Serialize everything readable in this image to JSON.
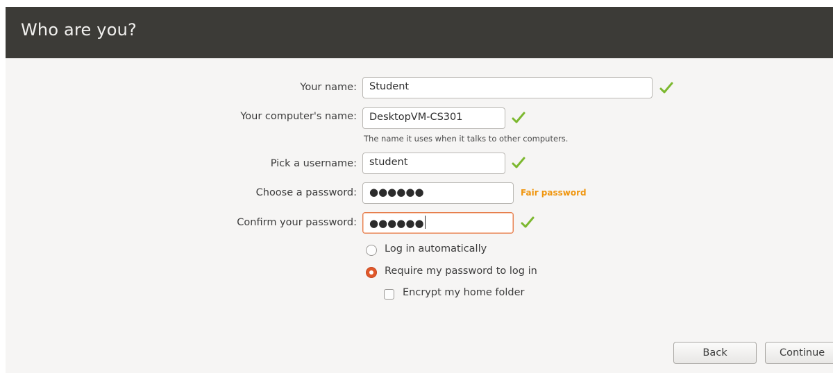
{
  "header": {
    "title": "Who are you?"
  },
  "form": {
    "name": {
      "label": "Your name:",
      "value": "Student"
    },
    "computer": {
      "label": "Your computer's name:",
      "value": "DesktopVM-CS301",
      "hint": "The name it uses when it talks to other computers."
    },
    "username": {
      "label": "Pick a username:",
      "value": "student"
    },
    "password": {
      "label": "Choose a password:",
      "masked": "●●●●●●",
      "strength": "Fair password"
    },
    "confirm": {
      "label": "Confirm your password:",
      "masked": "●●●●●●"
    }
  },
  "options": {
    "auto_login": "Log in automatically",
    "require_password": "Require my password to log in",
    "encrypt_home": "Encrypt my home folder",
    "selected": "require_password",
    "encrypt_checked": false
  },
  "buttons": {
    "back": "Back",
    "continue": "Continue"
  },
  "colors": {
    "header_bg": "#3c3b37",
    "check_green": "#7cb82f",
    "strength_orange": "#f0960f",
    "radio_accent": "#e0582a"
  }
}
